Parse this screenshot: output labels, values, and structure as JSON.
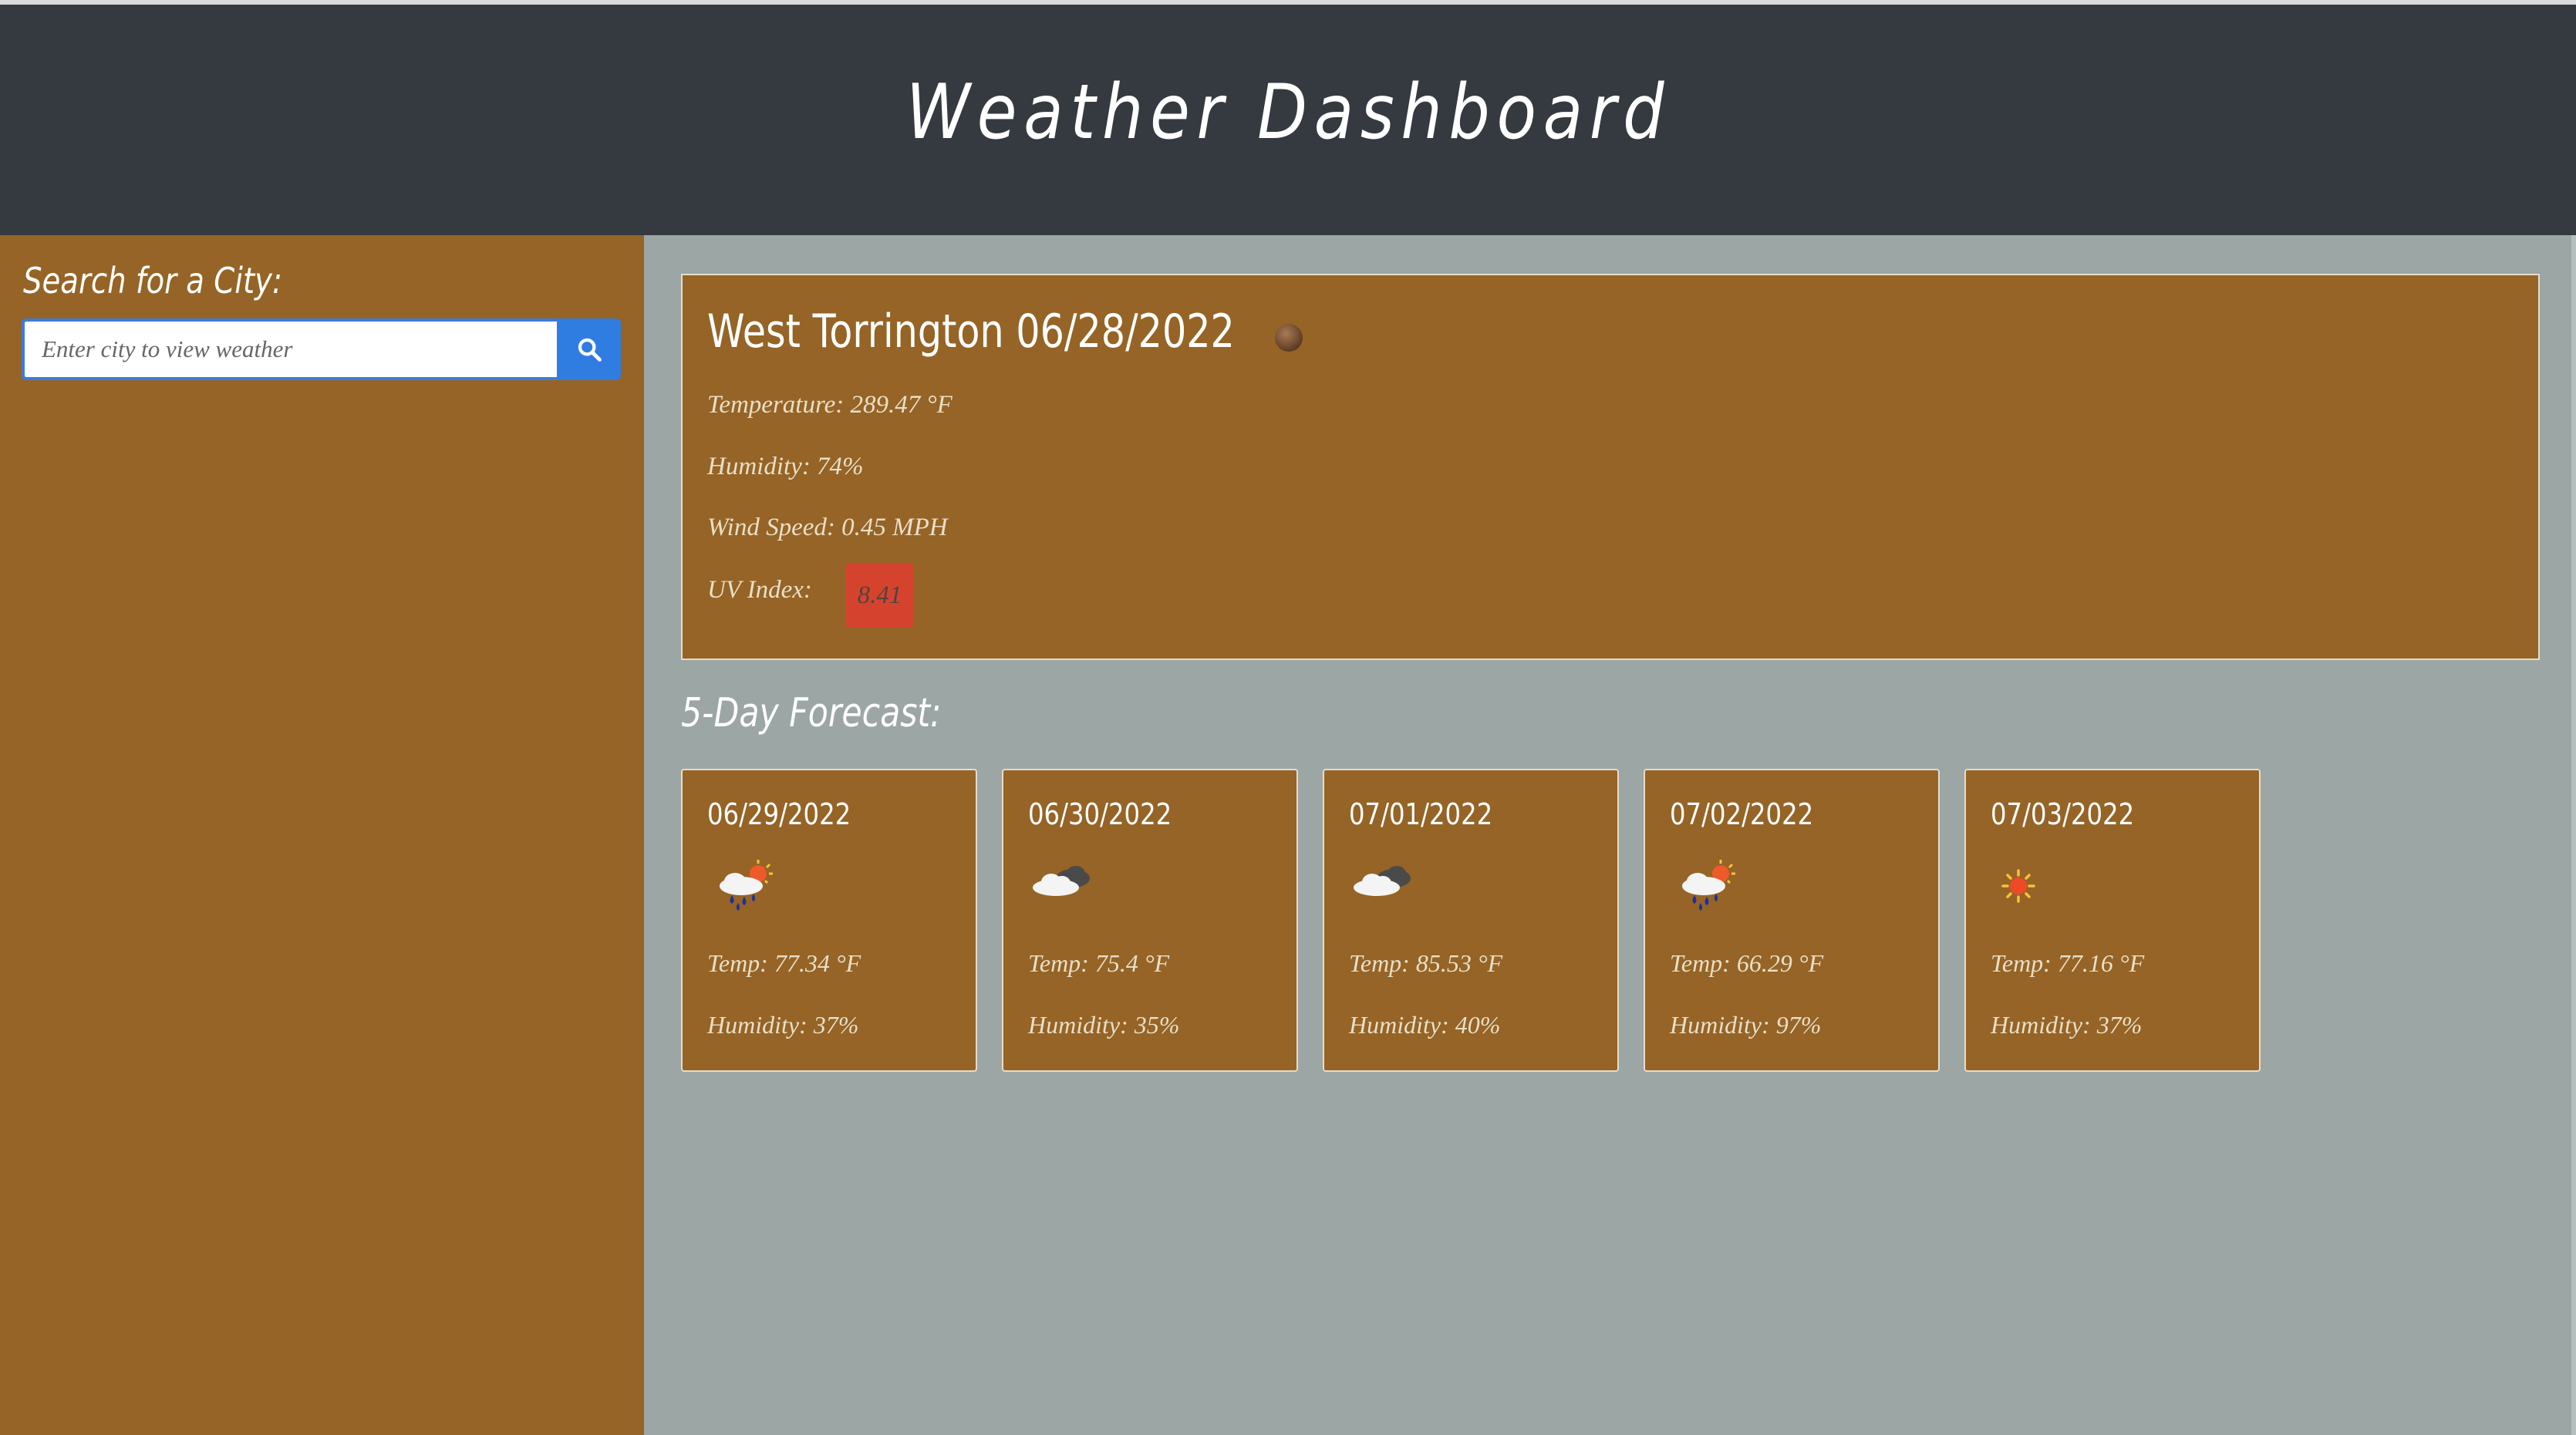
{
  "header": {
    "title": "Weather Dashboard"
  },
  "sidebar": {
    "title": "Search for a City:",
    "search": {
      "placeholder": "Enter city to view weather",
      "value": ""
    },
    "search_icon": "search-icon"
  },
  "current": {
    "title": "West Torrington 06/28/2022",
    "icon": "moon-icon",
    "temperature": "Temperature: 289.47 °F",
    "humidity": "Humidity: 74%",
    "wind": "Wind Speed: 0.45 MPH",
    "uv_label": "UV Index:",
    "uv_value": "8.41",
    "uv_color": "#d5432f"
  },
  "forecast": {
    "title": "5-Day Forecast:",
    "days": [
      {
        "date": "06/29/2022",
        "icon": "rain-sun-icon",
        "temp": "Temp: 77.34 °F",
        "humidity": "Humidity: 37%"
      },
      {
        "date": "06/30/2022",
        "icon": "cloud-icon",
        "temp": "Temp: 75.4 °F",
        "humidity": "Humidity: 35%"
      },
      {
        "date": "07/01/2022",
        "icon": "cloud-icon",
        "temp": "Temp: 85.53 °F",
        "humidity": "Humidity: 40%"
      },
      {
        "date": "07/02/2022",
        "icon": "rain-sun-icon",
        "temp": "Temp: 66.29 °F",
        "humidity": "Humidity: 97%"
      },
      {
        "date": "07/03/2022",
        "icon": "sun-icon",
        "temp": "Temp: 77.16 °F",
        "humidity": "Humidity: 37%"
      }
    ]
  },
  "colors": {
    "header": "#343a40",
    "panel": "#956426",
    "background": "#9ba6a5",
    "accent": "#2f7de1"
  }
}
